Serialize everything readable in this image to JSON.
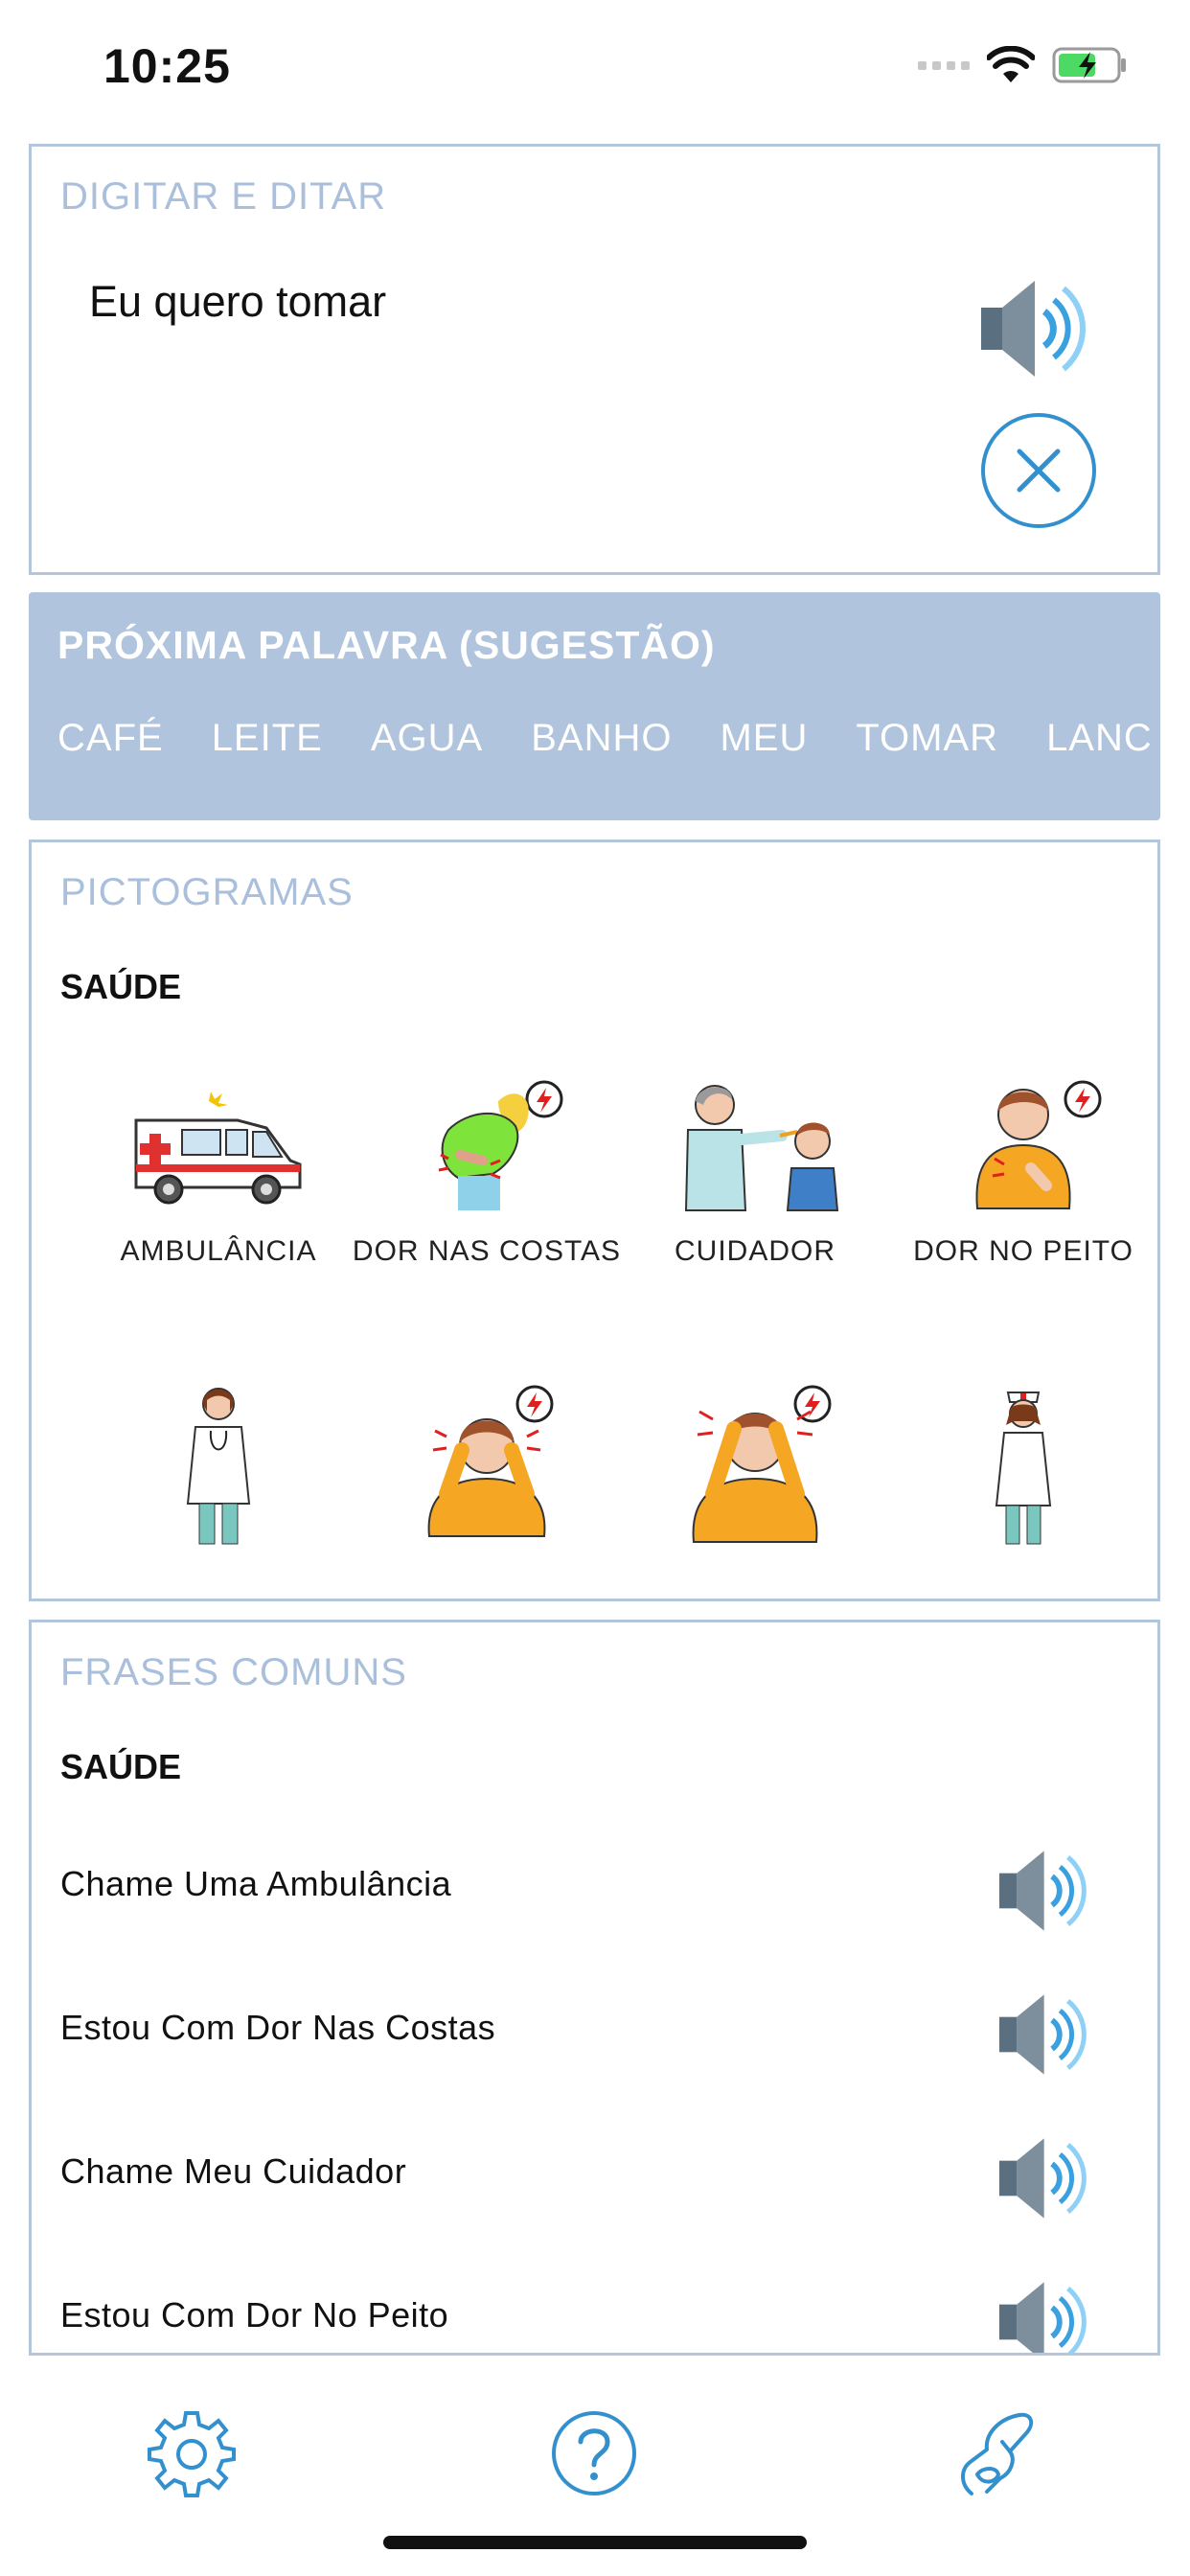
{
  "status_bar": {
    "time": "10:25"
  },
  "type_panel": {
    "title": "DIGITAR E DITAR",
    "text": "Eu quero tomar"
  },
  "suggestion_panel": {
    "title": "PRÓXIMA PALAVRA (SUGESTÃO)",
    "words": [
      "CAFÉ",
      "LEITE",
      "AGUA",
      "BANHO",
      "MEU",
      "TOMAR",
      "LANC"
    ]
  },
  "pictogram_panel": {
    "title": "PICTOGRAMAS",
    "category": "SAÚDE",
    "items": [
      {
        "label": "AMBULÂNCIA",
        "icon": "ambulance-icon"
      },
      {
        "label": "DOR NAS COSTAS",
        "icon": "back-pain-icon"
      },
      {
        "label": "CUIDADOR",
        "icon": "caregiver-icon"
      },
      {
        "label": "DOR NO PEITO",
        "icon": "chest-pain-icon"
      },
      {
        "label": "",
        "icon": "doctor-icon"
      },
      {
        "label": "",
        "icon": "ear-pain-icon"
      },
      {
        "label": "",
        "icon": "headache-icon"
      },
      {
        "label": "",
        "icon": "nurse-icon"
      }
    ]
  },
  "phrases_panel": {
    "title": "FRASES COMUNS",
    "category": "SAÚDE",
    "phrases": [
      "Chame Uma Ambulância",
      "Estou Com Dor Nas Costas",
      "Chame Meu Cuidador",
      "Estou Com Dor No Peito"
    ]
  },
  "tab_bar": {
    "icons": [
      "gear-icon",
      "help-icon",
      "sign-hand-icon"
    ]
  },
  "colors": {
    "accent": "#3390cf",
    "panel_border": "#b3c6dc",
    "suggestion_bg": "#b0c4dd",
    "muted_title": "#a9bfdb",
    "battery_green": "#4cd964"
  }
}
